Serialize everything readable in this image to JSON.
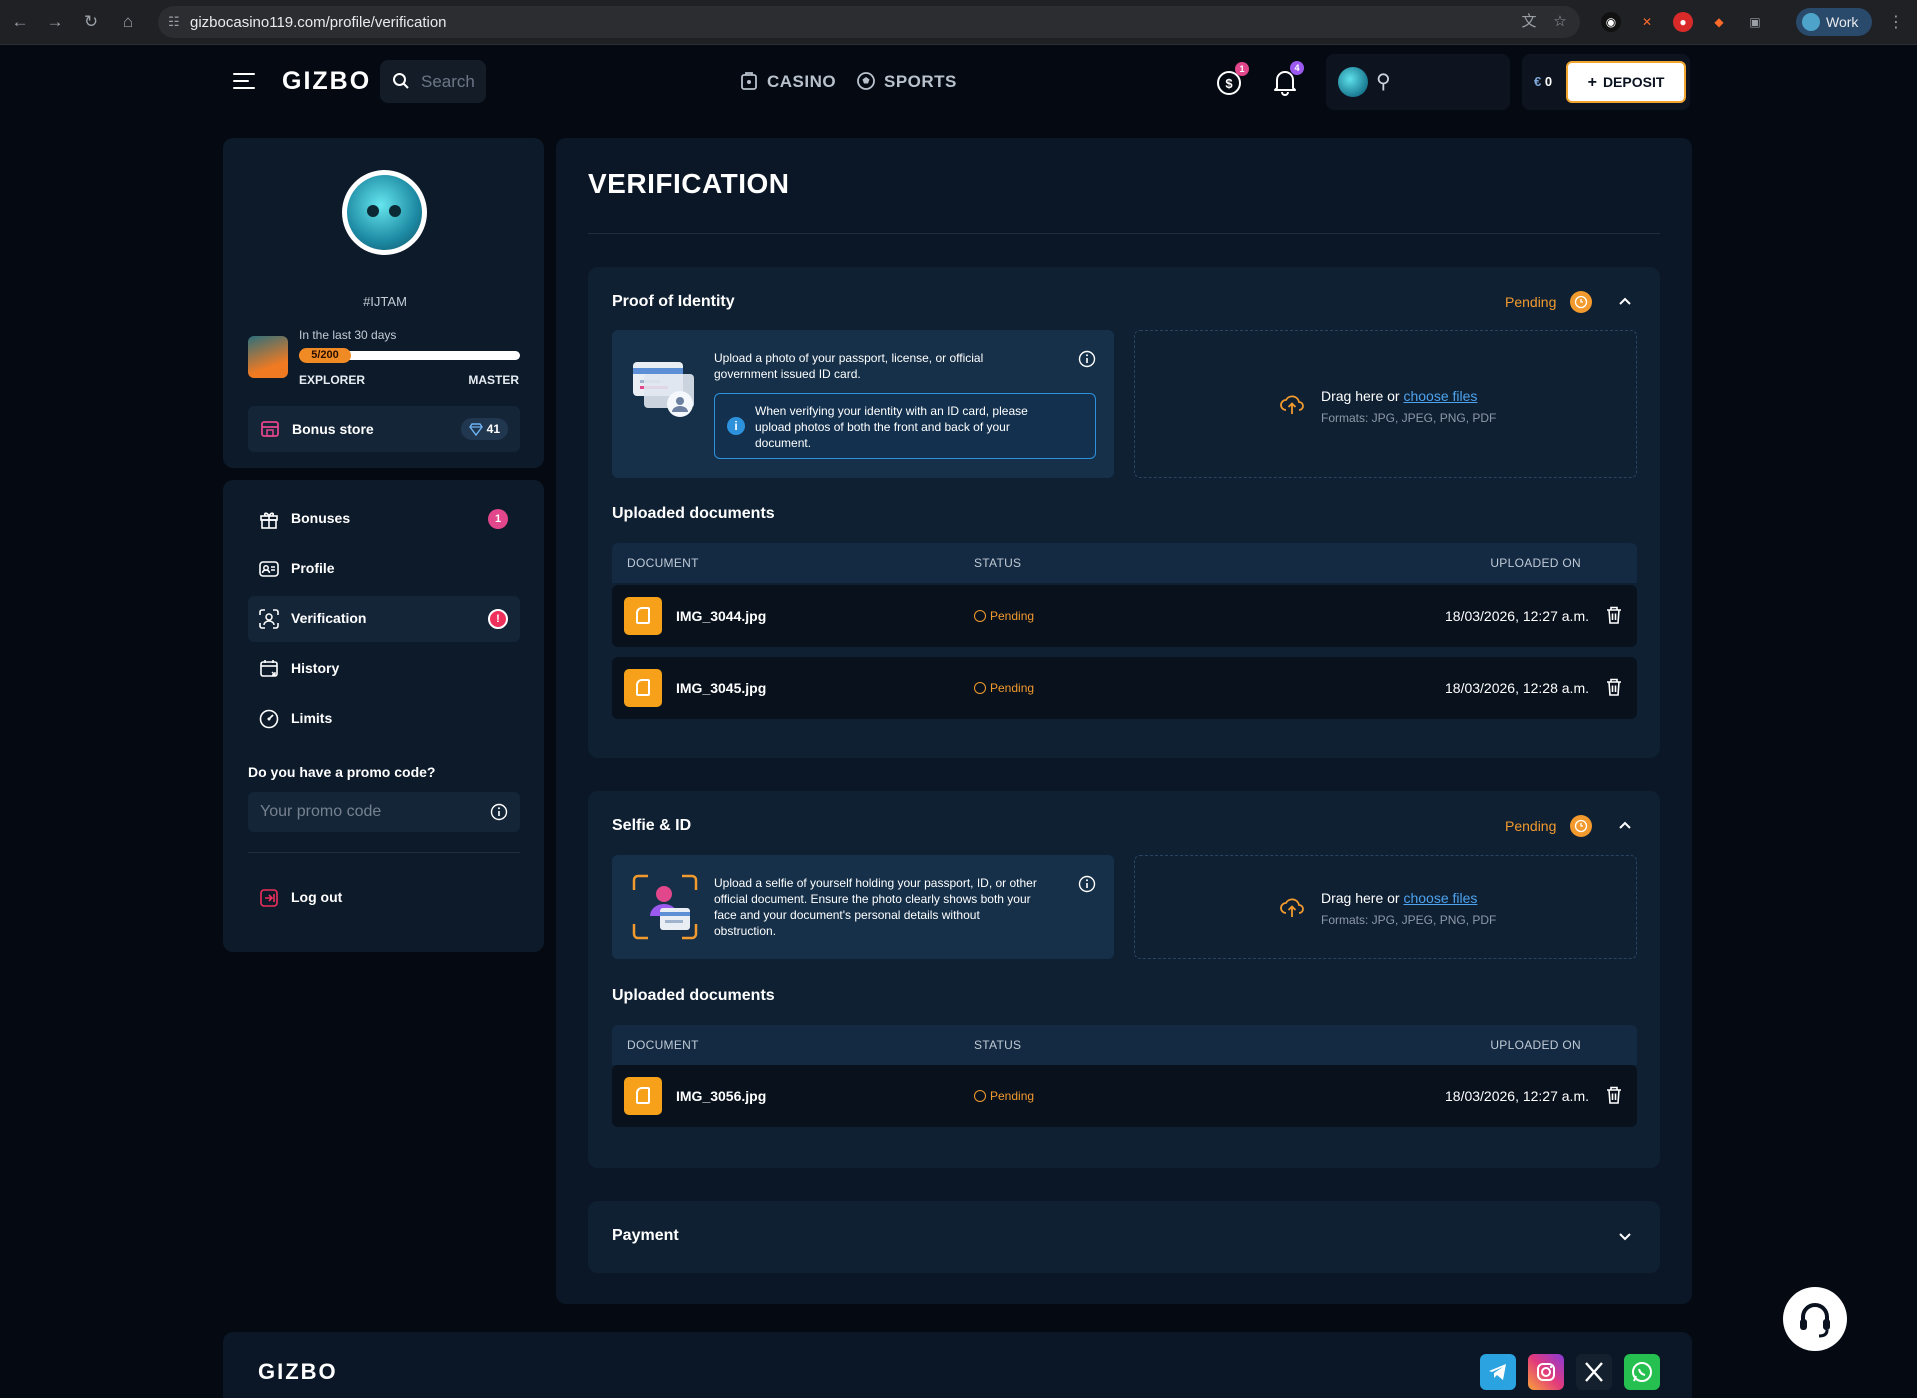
{
  "browser": {
    "url": "gizbocasino119.com/profile/verification",
    "profile_label": "Work"
  },
  "header": {
    "logo": "GIZBO",
    "search_placeholder": "Search",
    "nav": [
      {
        "label": "CASINO",
        "icon": "casino-icon"
      },
      {
        "label": "SPORTS",
        "icon": "sports-ball-icon"
      }
    ],
    "rewards_badge": "1",
    "notifications_badge": "4",
    "balance_currency": "€",
    "balance_value": "0",
    "deposit_label": "DEPOSIT"
  },
  "sidebar": {
    "username": "#IJTAM",
    "level_caption": "In the last 30 days",
    "progress_text": "5/200",
    "progress_fraction": 0.025,
    "level_from": "EXPLORER",
    "level_to": "MASTER",
    "bonus_store_label": "Bonus store",
    "bonus_store_gems": "41",
    "menu": [
      {
        "label": "Bonuses",
        "icon": "gift-icon",
        "badge": "1",
        "badge_color": "#e2468b"
      },
      {
        "label": "Profile",
        "icon": "id-card-icon",
        "badge": ""
      },
      {
        "label": "Verification",
        "icon": "face-scan-icon",
        "badge": "!",
        "badge_color": "#ef2f5c",
        "active": true
      },
      {
        "label": "History",
        "icon": "history-icon",
        "badge": ""
      },
      {
        "label": "Limits",
        "icon": "gauge-icon",
        "badge": ""
      }
    ],
    "promo_question": "Do you have a promo code?",
    "promo_placeholder": "Your promo code",
    "logout_label": "Log out"
  },
  "main": {
    "title": "VERIFICATION",
    "table_headers": {
      "document": "DOCUMENT",
      "status": "STATUS",
      "uploaded_on": "UPLOADED ON"
    },
    "dropzone": {
      "prefix": "Drag here or ",
      "link": "choose files",
      "formats": "Formats: JPG, JPEG, PNG, PDF"
    },
    "uploaded_title": "Uploaded documents",
    "sections": [
      {
        "title": "Proof of Identity",
        "status": "Pending",
        "instructions": "Upload a photo of your passport, license, or official government issued ID card.",
        "note": "When verifying your identity with an ID card, please upload photos of both the front and back of your document.",
        "documents": [
          {
            "name": "IMG_3044.jpg",
            "status": "Pending",
            "uploaded_on": "18/03/2026, 12:27 a.m."
          },
          {
            "name": "IMG_3045.jpg",
            "status": "Pending",
            "uploaded_on": "18/03/2026, 12:28 a.m."
          }
        ]
      },
      {
        "title": "Selfie & ID",
        "status": "Pending",
        "instructions": "Upload a selfie of yourself holding your passport, ID, or other official document. Ensure the photo clearly shows both your face and your document's personal details without obstruction.",
        "documents": [
          {
            "name": "IMG_3056.jpg",
            "status": "Pending",
            "uploaded_on": "18/03/2026, 12:27 a.m."
          }
        ]
      },
      {
        "title": "Payment"
      }
    ]
  },
  "footer": {
    "logo": "GIZBO",
    "social": [
      "telegram-icon",
      "instagram-icon",
      "x-icon",
      "whatsapp-icon"
    ]
  },
  "colors": {
    "accent": "#f29a2e",
    "link": "#4ea3ee",
    "background": "#050a12",
    "card": "#0c1a2a"
  }
}
